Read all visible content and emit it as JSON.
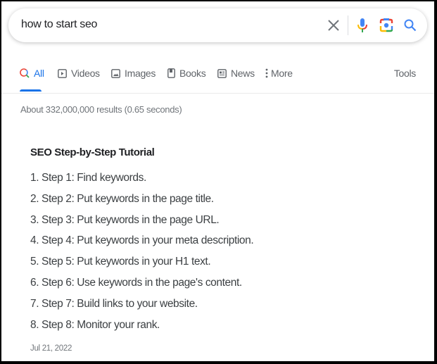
{
  "search": {
    "query": "how to start seo",
    "icons": {
      "clear": "close-icon",
      "voice": "microphone-icon",
      "lens": "camera-lens-icon",
      "submit": "search-icon"
    }
  },
  "tabs": [
    {
      "label": "All",
      "icon": "search-icon",
      "active": true
    },
    {
      "label": "Videos",
      "icon": "play-icon"
    },
    {
      "label": "Images",
      "icon": "image-icon"
    },
    {
      "label": "Books",
      "icon": "book-icon"
    },
    {
      "label": "News",
      "icon": "newspaper-icon"
    },
    {
      "label": "More",
      "icon": "more-vertical-icon"
    }
  ],
  "tools_label": "Tools",
  "result_stats": "About 332,000,000 results (0.65 seconds)",
  "featured_snippet": {
    "title": "SEO Step-by-Step Tutorial",
    "steps": [
      "1. Step 1: Find keywords.",
      "2. Step 2: Put keywords in the page title.",
      "3. Step 3: Put keywords in the page URL.",
      "4. Step 4: Put keywords in your meta description.",
      "5. Step 5: Put keywords in your H1 text.",
      "6. Step 6: Use keywords in the page's content.",
      "7. Step 7: Build links to your website.",
      "8. Step 8: Monitor your rank."
    ],
    "date": "Jul 21, 2022"
  },
  "colors": {
    "accent_blue": "#1a73e8",
    "google_red": "#ea4335",
    "google_yellow": "#fbbc04",
    "google_green": "#34a853",
    "google_blue": "#4285f4"
  }
}
